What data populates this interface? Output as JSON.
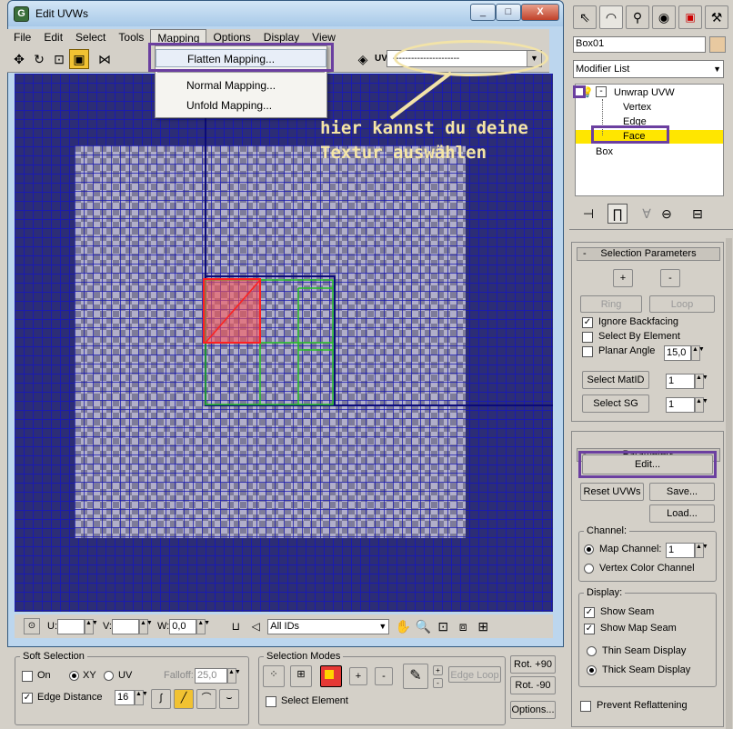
{
  "window": {
    "title": "Edit UVWs",
    "app_icon": "G",
    "caption_buttons": [
      "_",
      "□",
      "X"
    ]
  },
  "menubar": [
    "File",
    "Edit",
    "Select",
    "Tools",
    "Mapping",
    "Options",
    "Display",
    "View"
  ],
  "toolbar": {
    "uv_label": "UV",
    "texture_combo": "----------------------"
  },
  "mapping_menu": {
    "items": [
      "Flatten Mapping...",
      "Normal Mapping...",
      "Unfold Mapping..."
    ]
  },
  "annotation": {
    "text": "hier kannst du deine\nTextur auswählen",
    "color": "#f5e6a6"
  },
  "bottombar": {
    "u_label": "U:",
    "u_value": "",
    "v_label": "V:",
    "v_value": "",
    "w_label": "W:",
    "w_value": "0,0",
    "ids_combo": "All IDs"
  },
  "soft_selection": {
    "title": "Soft Selection",
    "on_label": "On",
    "xy_label": "XY",
    "uv_label": "UV",
    "falloff_label": "Falloff:",
    "falloff_value": "25,0",
    "edge_distance_label": "Edge Distance",
    "edge_distance_value": "16"
  },
  "selection_modes": {
    "title": "Selection Modes",
    "plus": "+",
    "minus": "-",
    "edge_loop": "Edge Loop",
    "select_element": "Select Element"
  },
  "rotate": {
    "rot_plus": "Rot. +90",
    "rot_minus": "Rot. -90",
    "options": "Options..."
  },
  "command_panel": {
    "object_name": "Box01",
    "modifier_list": "Modifier List",
    "stack": [
      "Unwrap UVW",
      "Vertex",
      "Edge",
      "Face",
      "Box"
    ]
  },
  "selection_parameters": {
    "title": "Selection Parameters",
    "plus": "+",
    "minus": "-",
    "ring": "Ring",
    "loop": "Loop",
    "ignore_backfacing": "Ignore Backfacing",
    "select_by_element": "Select By Element",
    "planar_angle": "Planar Angle",
    "planar_angle_value": "15,0",
    "select_matid": "Select MatID",
    "select_matid_value": "1",
    "select_sg": "Select SG",
    "select_sg_value": "1"
  },
  "parameters": {
    "title": "Parameters",
    "edit": "Edit...",
    "reset_uvws": "Reset UVWs",
    "save": "Save...",
    "load": "Load...",
    "channel_label": "Channel:",
    "map_channel": "Map Channel:",
    "map_channel_value": "1",
    "vertex_color_channel": "Vertex Color Channel",
    "display_label": "Display:",
    "show_seam": "Show Seam",
    "show_map_seam": "Show Map Seam",
    "thin_seam": "Thin Seam Display",
    "thick_seam": "Thick Seam Display",
    "prevent_reflattening": "Prevent Reflattening"
  },
  "colors": {
    "highlight_purple": "#6b3fa0",
    "viewport_bg": "#2c2d76",
    "face_selected": "#ffe600"
  }
}
